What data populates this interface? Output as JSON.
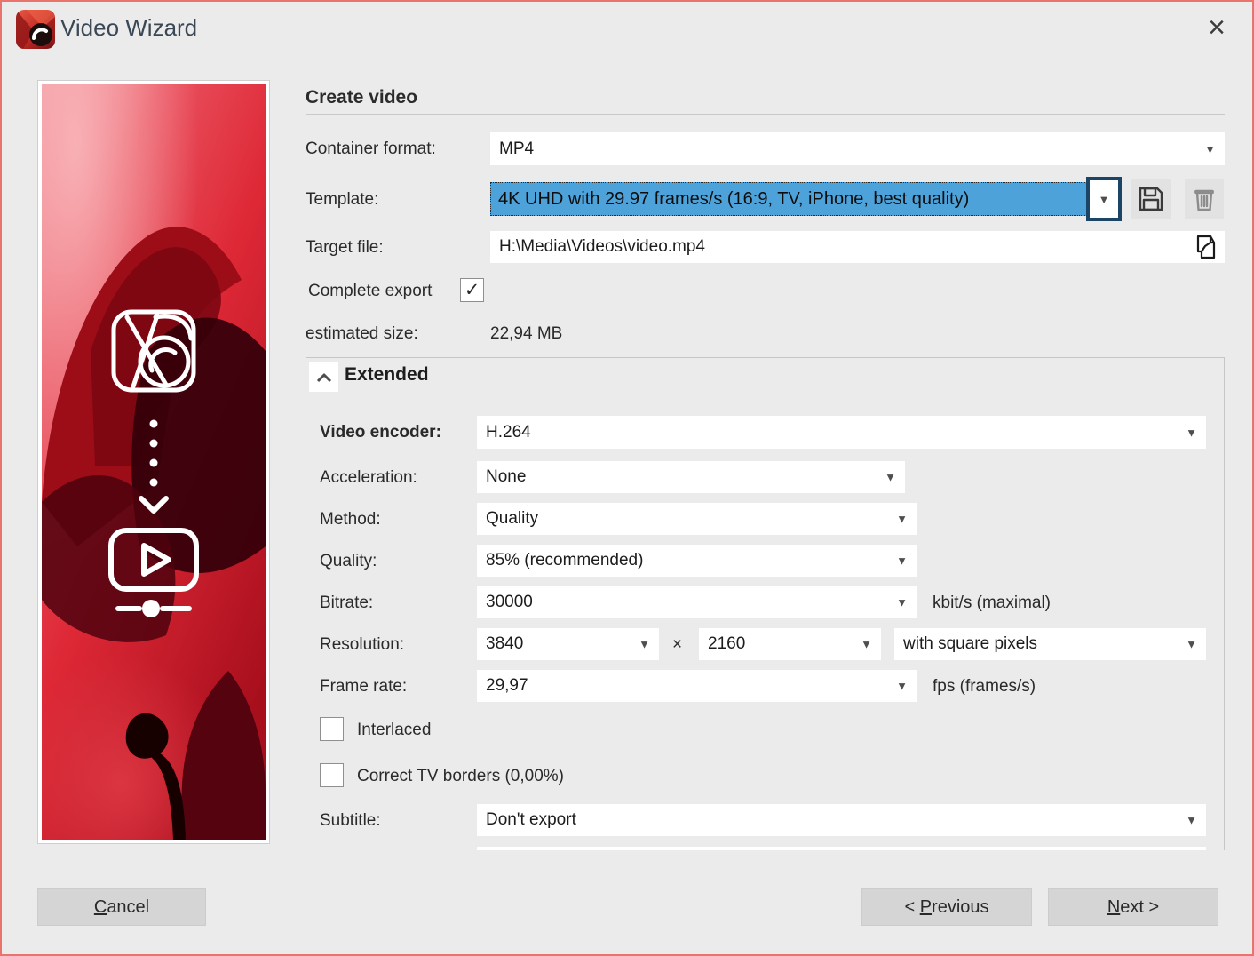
{
  "window": {
    "title": "Video Wizard"
  },
  "icons": {
    "close": "×",
    "dropdown_arrow": "▼",
    "checkmark": "✓"
  },
  "form": {
    "section_title": "Create video",
    "container_format": {
      "label": "Container format:",
      "value": "MP4"
    },
    "template": {
      "label": "Template:",
      "value": "4K UHD with 29.97 frames/s (16:9, TV, iPhone, best quality)"
    },
    "target_file": {
      "label": "Target file:",
      "value": "H:\\Media\\Videos\\video.mp4"
    },
    "complete_export": {
      "label": "Complete export",
      "checked": true
    },
    "estimated_size": {
      "label": "estimated size:",
      "value": "22,94 MB"
    }
  },
  "extended": {
    "title": "Extended",
    "video_encoder": {
      "label": "Video encoder:",
      "value": "H.264"
    },
    "acceleration": {
      "label": "Acceleration:",
      "value": "None"
    },
    "method": {
      "label": "Method:",
      "value": "Quality"
    },
    "quality": {
      "label": "Quality:",
      "value": "85% (recommended)"
    },
    "bitrate": {
      "label": "Bitrate:",
      "value": "30000",
      "unit": "kbit/s (maximal)"
    },
    "resolution": {
      "label": "Resolution:",
      "width": "3840",
      "separator": "×",
      "height": "2160",
      "pixel_mode": "with square pixels"
    },
    "frame_rate": {
      "label": "Frame rate:",
      "value": "29,97",
      "unit": "fps (frames/s)"
    },
    "interlaced": {
      "label": "Interlaced",
      "checked": false
    },
    "tv_borders": {
      "label": "Correct TV borders (0,00%)",
      "checked": false
    },
    "subtitle": {
      "label": "Subtitle:",
      "value": "Don't export"
    }
  },
  "footer": {
    "cancel": {
      "prefix": "",
      "accesskey": "C",
      "suffix": "ancel"
    },
    "previous": {
      "prefix": "< ",
      "accesskey": "P",
      "suffix": "revious"
    },
    "next": {
      "prefix": "",
      "accesskey": "N",
      "suffix": "ext >"
    }
  },
  "colors": {
    "selection_blue": "#4da2da",
    "focus_navy": "#1a4567",
    "window_border_salmon": "#e8746b",
    "dialog_background": "#ebebeb"
  }
}
